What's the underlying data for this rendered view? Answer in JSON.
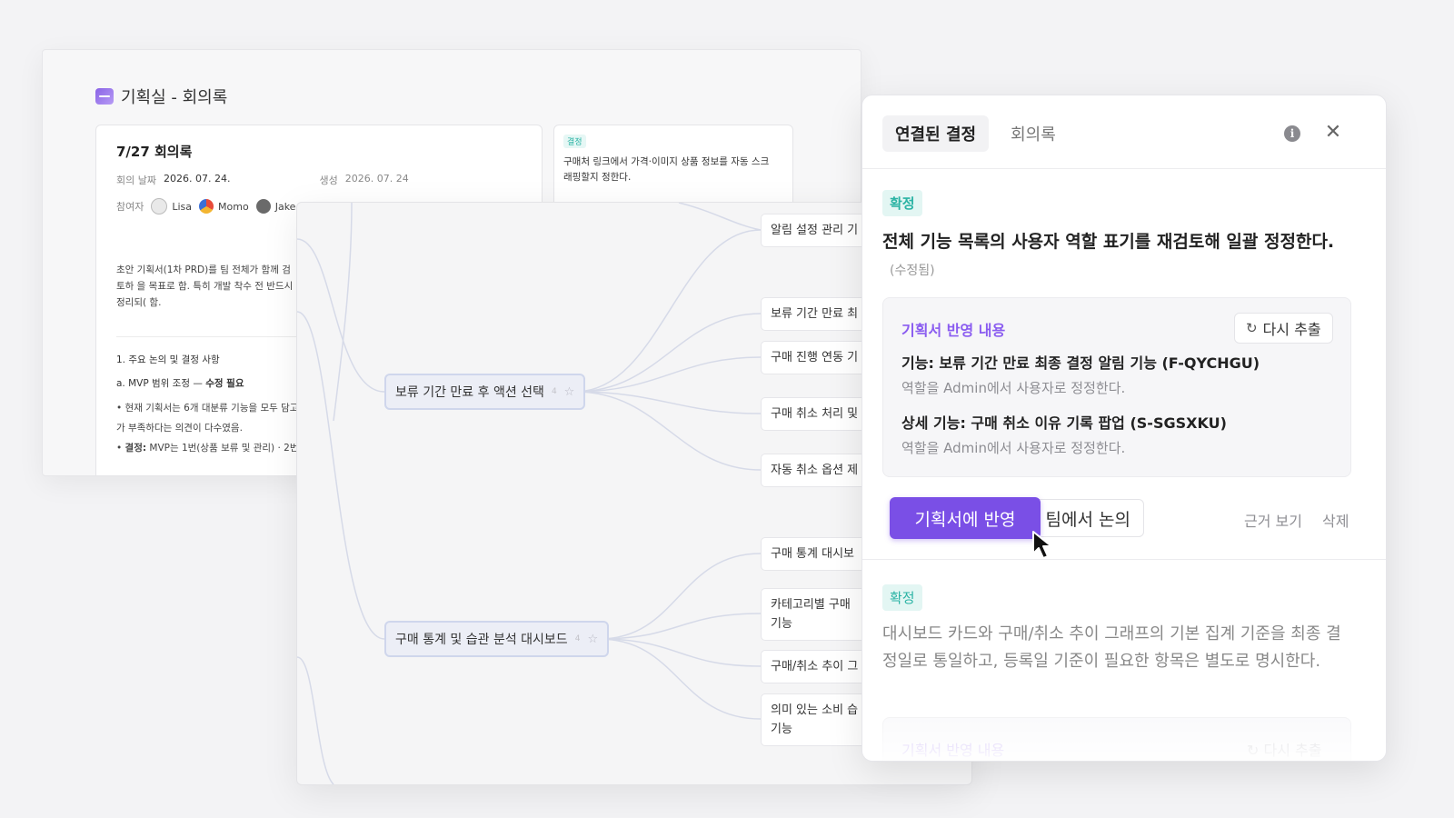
{
  "notes": {
    "title": "기획실 - 회의록",
    "card_title": "7/27 회의록",
    "meta_date_label": "회의 날짜",
    "meta_date": "2026. 07. 24.",
    "meta_created_label": "생성",
    "meta_created": "2026. 07. 24",
    "participants_label": "참여자",
    "participants": [
      "Lisa",
      "Momo",
      "Jake"
    ],
    "body": "초안 기획서(1차 PRD)를 팀 전체가 함께 검토하 을 목표로 함. 특히 개발 착수 전 반드시 정리되( 함.",
    "section1": "1. 주요 논의 및 결정 사항",
    "section1a": "a. MVP 범위 조정 — ",
    "section1a_bold": "수정 필요",
    "bullet1": "현재 기획서는 6개 대분류 기능을 모두 담고 스가 부족하다는 의견이 다수였음.",
    "bullet2_bold": "결정:",
    "bullet2": " MVP는 1번(상품 보류 및 관리) · 2번(",
    "decision_tag": "결정",
    "decision_text": "구매처 링크에서 가격·이미지 상품 정보를 자동 스크래핑할지 정한다."
  },
  "mindmap": {
    "nodes": [
      {
        "label": "보류 기간 만료 후 액션 선택",
        "count": "4"
      },
      {
        "label": "구매 통계 및 습관 분석 대시보드",
        "count": "4"
      }
    ],
    "leaves": [
      "알림 설정 관리 기",
      "보류 기간 만료 최",
      "구매 진행 연동 기",
      "구매 취소 처리 및",
      "자동 취소 옵션 제",
      "구매 통계 대시보",
      "카테고리별 구매\n기능",
      "구매/취소 추이 그",
      "의미 있는 소비 습\n기능"
    ]
  },
  "panel": {
    "tabs": [
      "연결된 결정",
      "회의록"
    ],
    "badge": "확정",
    "decision_title": "전체 기능 목록의 사용자 역할 표기를 재검토해 일괄 정정한다.",
    "decision_sub": "(수정됨)",
    "spec_label": "기획서 반영 내용",
    "reextract_label": "다시 추출",
    "spec_items": [
      {
        "title": "기능: 보류 기간 만료 최종 결정 알림 기능 (F-QYCHGU)",
        "desc": "역할을 Admin에서 사용자로 정정한다."
      },
      {
        "title": "상세 기능: 구매 취소 이유 기록 팝업 (S-SGSXKU)",
        "desc": "역할을 Admin에서 사용자로 정정한다."
      }
    ],
    "apply_label": "기획서에 반영",
    "discuss_label": "팀에서 논의",
    "evidence_label": "근거 보기",
    "delete_label": "삭제",
    "badge2": "확정",
    "decision2": "대시보드 카드와 구매/취소 추이 그래프의 기본 집계 기준을 최종 결정일로 통일하고, 등록일 기준이 필요한 항목은 별도로 명시한다.",
    "spec_label2": "기획서 반영 내용",
    "reextract_label2": "다시 추출"
  },
  "colors": {
    "accent": "#7a4fe6",
    "badge_teal": "#2ab3a4",
    "badge_bg": "#e3f6f3"
  },
  "icons": [
    "notebook-logo-icon",
    "star-icon",
    "refresh-icon",
    "info-icon",
    "close-icon",
    "cursor-arrow-icon"
  ]
}
